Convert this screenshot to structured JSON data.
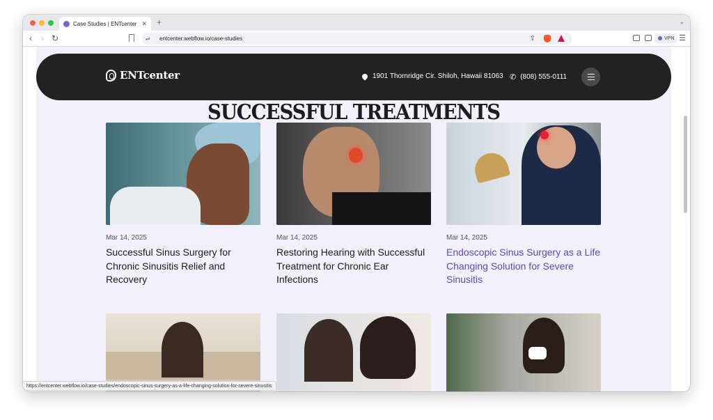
{
  "browser": {
    "tab_title": "Case Studies | ENTcenter - W",
    "url": "entcenter.webflow.io/case-studies",
    "vpn_label": "VPN",
    "status_url": "https://entcenter.webflow.io/case-studies/endoscopic-sinus-surgery-as-a-life-changing-solution-for-severe-sinusitis"
  },
  "icons": {
    "back": "‹",
    "forward": "›",
    "reload": "↻",
    "new_tab": "+",
    "tab_close": "✕",
    "tabs_menu": "⌄",
    "site_info": "⇌",
    "share": "⇪",
    "browser_menu": "☰",
    "phone": "✆"
  },
  "site": {
    "logo_text": "ENTcenter",
    "address": "1901 Thornridge Cir. Shiloh, Hawaii 81063",
    "phone": "(808) 555-0111",
    "section_title": "SUCCESSFUL TREATMENTS",
    "accent_color": "#5b4bb7",
    "header_color": "#222222"
  },
  "cards": [
    {
      "date": "Mar 14, 2025",
      "title": "Successful Sinus Surgery for Chronic Sinusitis Relief and Recovery"
    },
    {
      "date": "Mar 14, 2025",
      "title": "Restoring Hearing with Successful Treatment for Chronic Ear Infections"
    },
    {
      "date": "Mar 14, 2025",
      "title": "Endoscopic Sinus Surgery as a Life Changing Solution for Severe Sinusitis"
    }
  ]
}
